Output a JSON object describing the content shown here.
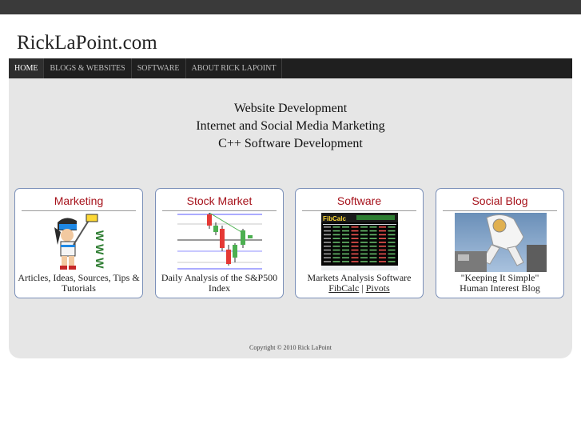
{
  "site": {
    "title": "RickLaPoint.com"
  },
  "nav": {
    "items": [
      "HOME",
      "BLOGS & WEBSITES",
      "SOFTWARE",
      "ABOUT RICK LAPOINT"
    ]
  },
  "headlines": [
    "Website Development",
    "Internet and Social Media Marketing",
    "C++ Software Development"
  ],
  "boxes": [
    {
      "title": "Marketing",
      "caption": "Articles, Ideas, Sources, Tips & Tutorials",
      "image_text": "W W W"
    },
    {
      "title": "Stock Market",
      "caption": "Daily Analysis of the S&P500 Index"
    },
    {
      "title": "Software",
      "caption": "Markets Analysis Software",
      "link1": "FibCalc",
      "separator": "|",
      "link2": "Pivots",
      "image_text": "FibCalc"
    },
    {
      "title": "Social Blog",
      "caption_line1": "\"Keeping It Simple\"",
      "caption_line2": "Human Interest Blog"
    }
  ],
  "footer": {
    "copyright": "Copyright © 2010 Rick LaPoint"
  },
  "colors": {
    "box_title": "#a6121b",
    "nav_bg": "#1f1f1f",
    "content_bg": "#e6e6e6",
    "box_border": "#7a8fb8"
  }
}
